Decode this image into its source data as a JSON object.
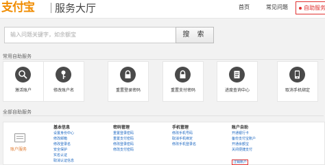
{
  "header": {
    "logo_text": "支付宝",
    "site_title": "服务大厅",
    "nav_home": "首页",
    "nav_faq": "常见问题",
    "nav_self_service": "自助服务"
  },
  "search": {
    "placeholder": "输入问题关键字，如余额宝",
    "button_label": "搜 索"
  },
  "common_services": {
    "title": "常用自助服务",
    "items": [
      {
        "label": "激活账户",
        "icon": "magnifier-icon"
      },
      {
        "label": "修改账户名",
        "icon": "key-icon"
      },
      {
        "label": "重置登录密码",
        "icon": "lock-icon"
      },
      {
        "label": "重置支付密码",
        "icon": "lock-icon"
      },
      {
        "label": "进度查询中心",
        "icon": "document-icon"
      },
      {
        "label": "取消手机绑定",
        "icon": "phone-icon"
      }
    ]
  },
  "all_services": {
    "title": "全部自助服务",
    "account_service_label": "账户服务",
    "columns": [
      {
        "head": "基本信息",
        "links": [
          "设置身份中心",
          "修改邮箱",
          "修改登录名",
          "安全保护",
          "实名认证",
          "取消认证信息"
        ]
      },
      {
        "head": "密码管理",
        "links": [
          "重置登录密码",
          "重置支付密码",
          "修改登录密码",
          "修改支付密码"
        ]
      },
      {
        "head": "手机管理",
        "links": [
          "修改手机号码",
          "取消手机绑定",
          "修改手机登录名"
        ]
      },
      {
        "head": "账户自助",
        "links": [
          "开通银行卡",
          "备份支付宝账户",
          "开通余额宝",
          "关闭便捷支付",
          "注销账户"
        ]
      }
    ],
    "highlighted_link": "注销账户"
  },
  "colors": {
    "accent_orange": "#f08c00",
    "highlight_red": "#e0302f",
    "link_blue": "#1a66c0"
  }
}
